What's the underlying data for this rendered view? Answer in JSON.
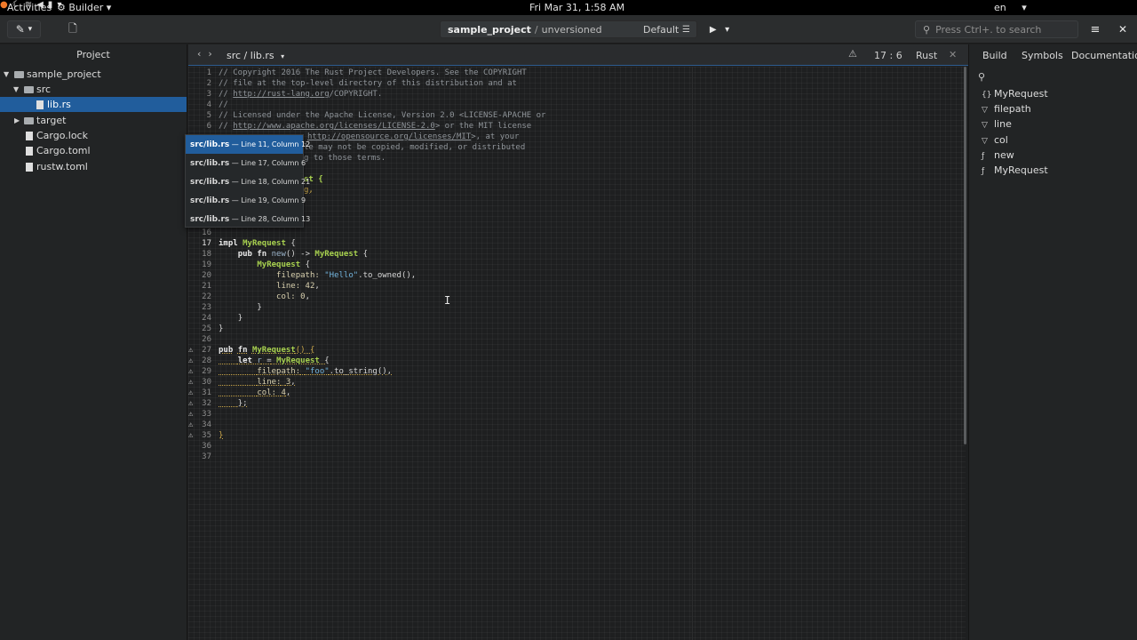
{
  "topbar": {
    "activities": "Activities",
    "app_name": "Builder",
    "clock": "Fri Mar 31,  1:58 AM",
    "lang": "en"
  },
  "header": {
    "project": "sample_project",
    "separator": "/",
    "vcs": "unversioned",
    "config": "Default",
    "search_placeholder": "Press Ctrl+. to search"
  },
  "sidebar": {
    "title": "Project",
    "items": [
      {
        "label": "sample_project"
      },
      {
        "label": "src"
      },
      {
        "label": "lib.rs"
      },
      {
        "label": "target"
      },
      {
        "label": "Cargo.lock"
      },
      {
        "label": "Cargo.toml"
      },
      {
        "label": "rustw.toml"
      }
    ]
  },
  "editor": {
    "path": "src / lib.rs",
    "position": "17 : 6",
    "language": "Rust",
    "lines": {
      "l1": "// Copyright 2016 The Rust Project Developers. See the COPYRIGHT",
      "l2": "// file at the top-level directory of this distribution and at",
      "l3a": "// ",
      "l3b": "http://rust-lang.org",
      "l3c": "/COPYRIGHT.",
      "l4": "//",
      "l5": "// Licensed under the Apache License, Version 2.0 <LICENSE-APACHE or",
      "l6a": "// ",
      "l6b": "http://www.apache.org/licenses/LICENSE-2.0",
      "l6c": "> or the MIT license",
      "l7a": "http://opensource.org/licenses/MIT",
      "l7b": ">, at your",
      "l8": "le may not be copied, modified, or distributed",
      "l9": "g to those terms.",
      "l11": "st {",
      "l12": "g,"
    }
  },
  "popup": {
    "items": [
      {
        "file": "src/lib.rs",
        "loc": " — Line 11, Column 12"
      },
      {
        "file": "src/lib.rs",
        "loc": " — Line 17, Column 6"
      },
      {
        "file": "src/lib.rs",
        "loc": " — Line 18, Column 21"
      },
      {
        "file": "src/lib.rs",
        "loc": " — Line 19, Column 9"
      },
      {
        "file": "src/lib.rs",
        "loc": " — Line 28, Column 13"
      }
    ]
  },
  "right_panel": {
    "tabs": [
      "Build",
      "Symbols",
      "Documentation"
    ],
    "symbols": [
      {
        "label": "MyRequest",
        "icon": "struct-icon"
      },
      {
        "label": "filepath",
        "icon": "field-icon"
      },
      {
        "label": "line",
        "icon": "field-icon"
      },
      {
        "label": "col",
        "icon": "field-icon"
      },
      {
        "label": "new",
        "icon": "function-icon"
      },
      {
        "label": "MyRequest",
        "icon": "function-icon"
      }
    ]
  },
  "colors": {
    "selection": "#215d9c",
    "type": "#a8d14f",
    "string": "#72b3dc",
    "comment": "#8f9499"
  }
}
